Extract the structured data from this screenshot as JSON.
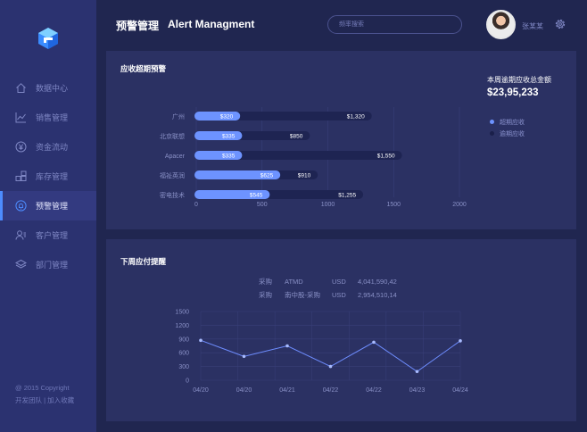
{
  "colors": {
    "accent": "#4d8cff",
    "bar_overdue": "#6d93ff",
    "bar_due": "#1e2452",
    "sidebar_bg": "#2b3270",
    "card_bg": "#2b3163",
    "line": "#6e8dff"
  },
  "logo": {
    "icon": "cube-logo-icon"
  },
  "sidebar": {
    "items": [
      {
        "label": "数据中心",
        "icon": "home-icon",
        "active": false
      },
      {
        "label": "销售管理",
        "icon": "trend-chart-icon",
        "active": false
      },
      {
        "label": "资金流动",
        "icon": "yen-icon",
        "active": false
      },
      {
        "label": "库存管理",
        "icon": "boxes-icon",
        "active": false
      },
      {
        "label": "预警管理",
        "icon": "alert-icon",
        "active": true
      },
      {
        "label": "客户管理",
        "icon": "customer-icon",
        "active": false
      },
      {
        "label": "部门管理",
        "icon": "layers-icon",
        "active": false
      }
    ],
    "footer": {
      "copyright": "@ 2015 Copyright",
      "link_team": "开发团队",
      "separator": " | ",
      "link_favorite": "加入收藏"
    }
  },
  "header": {
    "title_cn": "预警管理",
    "title_en": "Alert Managment",
    "search_placeholder": "频率搜索",
    "username": "张某某",
    "gear_icon": "gear-icon"
  },
  "overdue_card": {
    "title": "应收超期预警",
    "total_label": "本周逾期应收总金额",
    "total_value": "$23,95,233",
    "legend": [
      {
        "label": "超期应收",
        "color": "#6d93ff"
      },
      {
        "label": "逾期应收",
        "color": "#1e2452"
      }
    ]
  },
  "payment_card": {
    "title": "下周应付提醒",
    "rows": [
      {
        "type": "采购",
        "vendor": "ATMD",
        "currency": "USD",
        "amount": "4,041,590,42"
      },
      {
        "type": "采购",
        "vendor": "南中股-采购",
        "currency": "USD",
        "amount": "2,954,510,14"
      }
    ]
  },
  "chart_data": [
    {
      "type": "bar",
      "orientation": "horizontal",
      "categories": [
        "广州",
        "北京联想",
        "Apacer",
        "福祉英润",
        "密电技术"
      ],
      "series": [
        {
          "name": "超期应收",
          "values": [
            320,
            335,
            335,
            625,
            545
          ],
          "labels": [
            "$320",
            "$335",
            "$335",
            "$625",
            "$545"
          ]
        },
        {
          "name": "逾期应收",
          "values": [
            1320,
            850,
            1550,
            910,
            1255
          ],
          "labels": [
            "$1,320",
            "$850",
            "$1,550",
            "$910",
            "$1,255"
          ]
        }
      ],
      "xlim": [
        0,
        2000
      ],
      "xticks": [
        "0",
        "500",
        "1000",
        "1500",
        "2000"
      ],
      "legend": "right"
    },
    {
      "type": "line",
      "x": [
        "04/20",
        "04/20",
        "04/21",
        "04/22",
        "04/22",
        "04/23",
        "04/24"
      ],
      "series": [
        {
          "values": [
            870,
            520,
            750,
            300,
            830,
            190,
            860
          ]
        }
      ],
      "ylim": [
        0,
        1500
      ],
      "yticks": [
        "0",
        "300",
        "600",
        "900",
        "1200",
        "1500"
      ],
      "grid": true
    }
  ]
}
